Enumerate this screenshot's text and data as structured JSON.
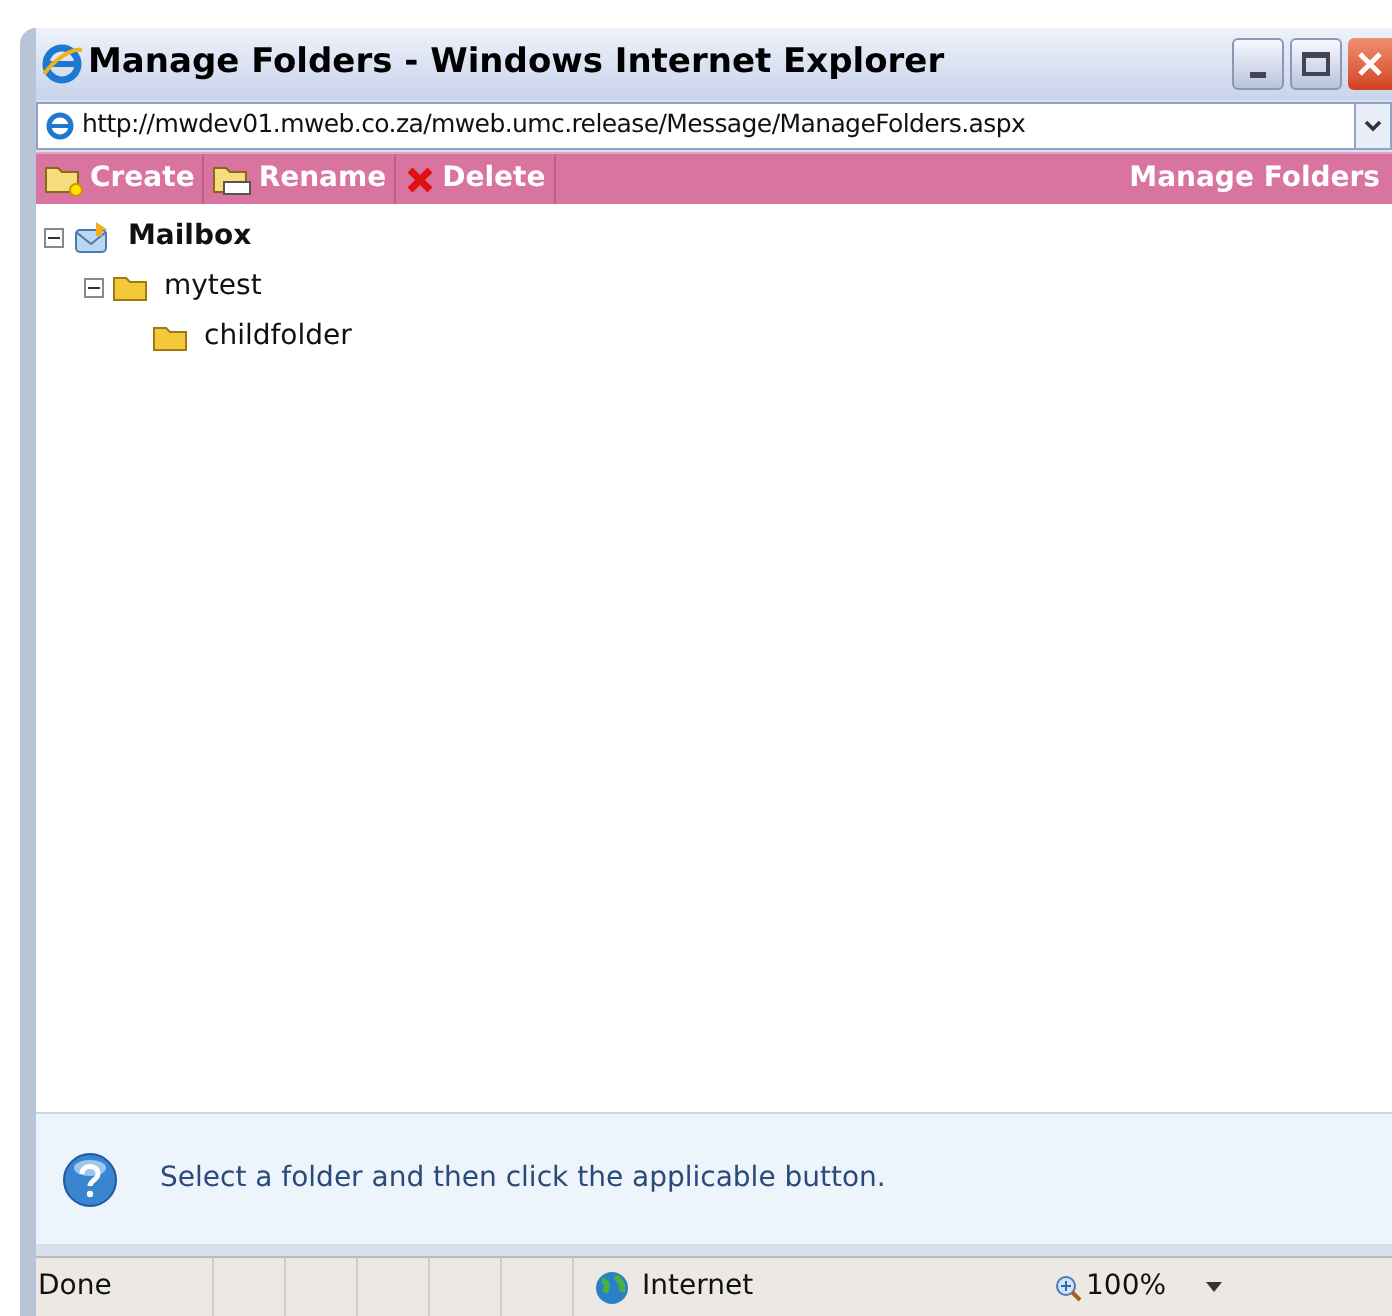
{
  "window": {
    "title": "Manage Folders - Windows Internet Explorer"
  },
  "address_bar": {
    "value": "http://mwdev01.mweb.co.za/mweb.umc.release/Message/ManageFolders.aspx"
  },
  "toolbar": {
    "buttons": [
      {
        "label": "Create",
        "kind": "create"
      },
      {
        "label": "Rename",
        "kind": "rename"
      },
      {
        "label": "Delete",
        "kind": "delete"
      }
    ],
    "title": "Manage Folders"
  },
  "tree": [
    {
      "label": "Mailbox",
      "kind": "mailbox",
      "expanded": true,
      "children": [
        {
          "label": "mytest",
          "kind": "folder",
          "expanded": true,
          "children": [
            {
              "label": "childfolder",
              "kind": "folder"
            }
          ]
        }
      ]
    }
  ],
  "info": {
    "message": "Select a folder and then click the applicable button."
  },
  "status_bar": {
    "status": "Done",
    "zone": "Internet",
    "zoom": "100%"
  }
}
